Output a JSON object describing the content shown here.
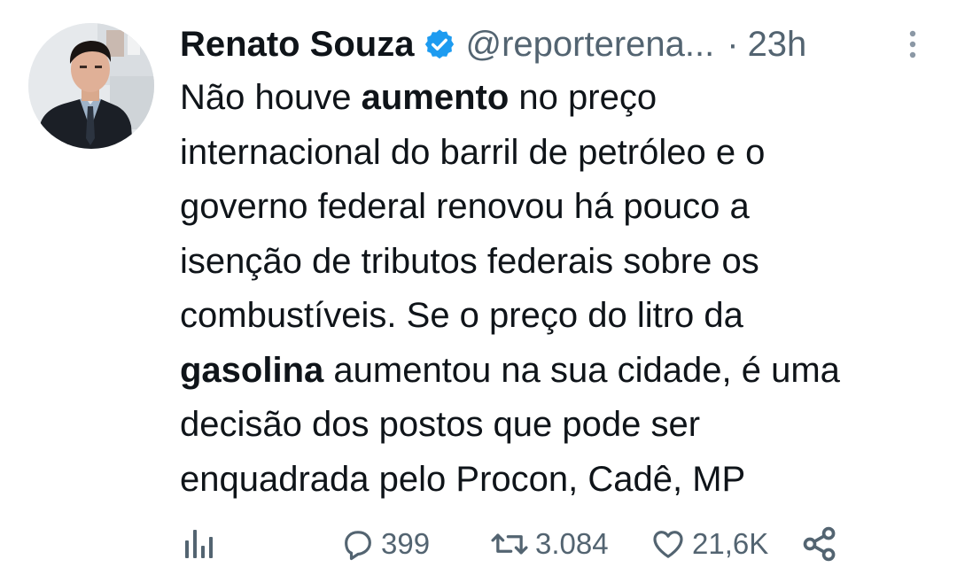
{
  "author": {
    "name": "Renato Souza",
    "handle": "@reporterena...",
    "separator": "·",
    "time": "23h"
  },
  "icons": {
    "verified": "verified-badge-icon",
    "more": "more-options-icon",
    "views": "views-icon",
    "reply": "reply-icon",
    "retweet": "retweet-icon",
    "like": "like-icon",
    "share": "share-icon"
  },
  "colors": {
    "verified_blue": "#1d9bf0",
    "text": "#0f1419",
    "secondary": "#536471"
  },
  "tweet": {
    "lines": [
      [
        "Não houve ",
        "aumento",
        " no preço"
      ],
      [
        "internacional do barril de petróleo e o"
      ],
      [
        "governo federal renovou há pouco a"
      ],
      [
        "isenção de tributos federais sobre os"
      ],
      [
        "combustíveis. Se o preço do litro da"
      ],
      [
        "",
        "gasolina",
        " aumentou na sua cidade, é uma"
      ],
      [
        "decisão dos postos que pode ser"
      ],
      [
        "enquadrada pelo Procon, Cadê, MP"
      ]
    ]
  },
  "actions": {
    "replies": "399",
    "retweets": "3.084",
    "likes": "21,6K"
  }
}
